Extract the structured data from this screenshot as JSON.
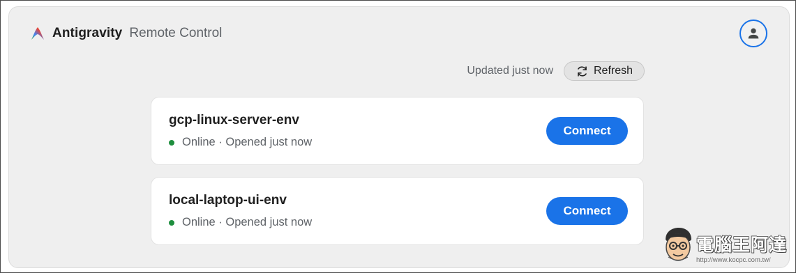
{
  "header": {
    "brand_name": "Antigravity",
    "brand_subtitle": "Remote Control",
    "logo_icon": "antigravity-logo",
    "account_icon": "account-icon"
  },
  "toolbar": {
    "updated_text": "Updated just now",
    "refresh_label": "Refresh",
    "refresh_icon": "refresh-icon"
  },
  "environments": [
    {
      "name": "gcp-linux-server-env",
      "status": "Online · Opened just now",
      "status_color": "#1e8e3e",
      "action_label": "Connect"
    },
    {
      "name": "local-laptop-ui-env",
      "status": "Online · Opened just now",
      "status_color": "#1e8e3e",
      "action_label": "Connect"
    }
  ],
  "watermark": {
    "title": "電腦王阿達",
    "url": "http://www.kocpc.com.tw/"
  },
  "colors": {
    "accent": "#1a73e8",
    "online": "#1e8e3e",
    "panel_bg": "#efefef"
  }
}
